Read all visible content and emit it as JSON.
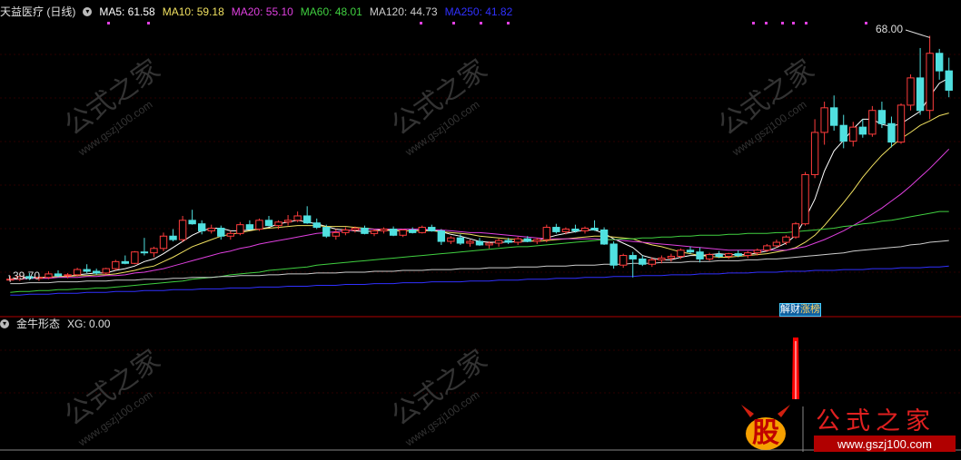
{
  "main_legend": {
    "title": "天益医疗 (日线)",
    "mas": [
      {
        "label": "MA5: 61.58",
        "color": "#ffffff"
      },
      {
        "label": "MA10: 59.18",
        "color": "#f0e060"
      },
      {
        "label": "MA20: 55.10",
        "color": "#e040e0"
      },
      {
        "label": "MA60: 48.01",
        "color": "#40d040"
      },
      {
        "label": "MA120: 44.73",
        "color": "#cccccc"
      },
      {
        "label": "MA250: 41.82",
        "color": "#3030ff"
      }
    ]
  },
  "sub_legend": {
    "title": "金牛形态",
    "value": "XG: 0.00"
  },
  "annotations": {
    "high": "68.00",
    "low": "39.70",
    "tag1": "解",
    "tag2": "财",
    "tag3": "涨",
    "tag4": "榜"
  },
  "watermark": {
    "text": "公式之家",
    "url": "www.gszj100.com"
  },
  "logo": {
    "glyph": "股",
    "text": "公式之家",
    "url": "www.gszj100.com"
  },
  "colors": {
    "up": "#ff3c3c",
    "down": "#50e0e0",
    "signal": "#ff0000",
    "grid": "#b00000"
  },
  "chart_data": {
    "type": "candlestick",
    "title": "天益医疗 (日线)",
    "y_range": [
      38,
      70
    ],
    "candles": [
      [
        40.2,
        40.7,
        40.0,
        40.3
      ],
      [
        40.3,
        40.9,
        40.1,
        40.6
      ],
      [
        40.6,
        41.0,
        40.2,
        40.4
      ],
      [
        40.4,
        40.8,
        40.1,
        40.5
      ],
      [
        40.5,
        41.2,
        40.3,
        40.9
      ],
      [
        40.9,
        41.3,
        40.5,
        40.7
      ],
      [
        40.7,
        41.0,
        40.4,
        40.8
      ],
      [
        40.8,
        41.6,
        40.6,
        41.4
      ],
      [
        41.4,
        42.0,
        41.0,
        41.2
      ],
      [
        41.2,
        41.5,
        40.8,
        41.0
      ],
      [
        41.0,
        41.6,
        40.8,
        41.5
      ],
      [
        41.5,
        42.5,
        41.3,
        42.3
      ],
      [
        42.3,
        43.0,
        42.0,
        42.1
      ],
      [
        42.1,
        43.5,
        42.0,
        43.4
      ],
      [
        43.4,
        45.0,
        43.0,
        43.3
      ],
      [
        43.3,
        44.0,
        42.8,
        43.8
      ],
      [
        43.8,
        45.6,
        43.5,
        45.2
      ],
      [
        45.2,
        46.0,
        44.6,
        44.8
      ],
      [
        44.8,
        47.5,
        44.5,
        47.0
      ],
      [
        47.0,
        48.2,
        46.5,
        46.6
      ],
      [
        46.6,
        47.0,
        45.4,
        45.8
      ],
      [
        45.8,
        46.5,
        45.5,
        46.1
      ],
      [
        46.1,
        46.4,
        44.8,
        45.2
      ],
      [
        45.2,
        45.8,
        44.8,
        45.5
      ],
      [
        45.5,
        46.8,
        45.3,
        46.5
      ],
      [
        46.5,
        47.0,
        45.9,
        46.0
      ],
      [
        46.0,
        47.2,
        45.8,
        47.0
      ],
      [
        47.0,
        47.5,
        46.3,
        46.4
      ],
      [
        46.4,
        47.0,
        46.0,
        46.8
      ],
      [
        46.8,
        47.6,
        46.4,
        47.0
      ],
      [
        47.0,
        48.0,
        46.8,
        47.5
      ],
      [
        47.5,
        48.6,
        46.6,
        46.7
      ],
      [
        46.7,
        47.2,
        46.0,
        46.2
      ],
      [
        46.2,
        46.5,
        45.0,
        45.2
      ],
      [
        45.2,
        46.0,
        44.8,
        45.6
      ],
      [
        45.6,
        46.2,
        45.3,
        45.9
      ],
      [
        45.9,
        46.3,
        45.6,
        46.1
      ],
      [
        46.1,
        46.4,
        45.4,
        45.5
      ],
      [
        45.5,
        46.0,
        45.2,
        45.8
      ],
      [
        45.8,
        46.2,
        45.5,
        46.0
      ],
      [
        46.0,
        46.3,
        45.2,
        45.3
      ],
      [
        45.3,
        46.0,
        45.1,
        45.9
      ],
      [
        45.9,
        46.2,
        45.5,
        45.6
      ],
      [
        45.6,
        46.4,
        45.5,
        46.2
      ],
      [
        46.2,
        46.5,
        45.7,
        45.8
      ],
      [
        45.8,
        46.0,
        44.2,
        44.6
      ],
      [
        44.6,
        45.2,
        44.3,
        45.0
      ],
      [
        45.0,
        45.4,
        44.2,
        44.4
      ],
      [
        44.4,
        44.8,
        44.0,
        44.6
      ],
      [
        44.6,
        45.0,
        44.1,
        44.2
      ],
      [
        44.2,
        44.6,
        43.8,
        44.4
      ],
      [
        44.4,
        44.9,
        44.0,
        44.7
      ],
      [
        44.7,
        45.0,
        44.3,
        44.5
      ],
      [
        44.5,
        45.1,
        44.2,
        44.9
      ],
      [
        44.9,
        45.2,
        44.5,
        44.6
      ],
      [
        44.6,
        45.0,
        44.3,
        44.8
      ],
      [
        44.8,
        46.5,
        44.5,
        46.2
      ],
      [
        46.2,
        46.6,
        45.5,
        45.7
      ],
      [
        45.7,
        46.2,
        45.4,
        46.0
      ],
      [
        46.0,
        46.5,
        45.6,
        45.8
      ],
      [
        45.8,
        46.3,
        45.5,
        46.1
      ],
      [
        46.1,
        47.0,
        45.8,
        45.9
      ],
      [
        45.9,
        46.2,
        44.2,
        44.3
      ],
      [
        44.3,
        44.6,
        41.5,
        41.9
      ],
      [
        41.9,
        43.2,
        41.6,
        43.0
      ],
      [
        43.0,
        43.4,
        40.5,
        42.6
      ],
      [
        42.6,
        43.0,
        41.8,
        42.0
      ],
      [
        42.0,
        42.8,
        41.7,
        42.5
      ],
      [
        42.5,
        43.0,
        42.1,
        42.7
      ],
      [
        42.7,
        43.2,
        42.3,
        42.9
      ],
      [
        42.9,
        43.8,
        42.6,
        43.6
      ],
      [
        43.6,
        44.0,
        43.2,
        43.4
      ],
      [
        43.4,
        43.9,
        42.2,
        42.6
      ],
      [
        42.6,
        43.3,
        42.4,
        43.1
      ],
      [
        43.1,
        43.5,
        42.7,
        42.9
      ],
      [
        42.9,
        43.3,
        42.6,
        43.2
      ],
      [
        43.2,
        43.6,
        42.8,
        43.0
      ],
      [
        43.0,
        43.5,
        42.7,
        43.3
      ],
      [
        43.3,
        43.8,
        43.0,
        43.6
      ],
      [
        43.6,
        44.3,
        43.4,
        44.1
      ],
      [
        44.1,
        44.8,
        43.9,
        44.5
      ],
      [
        44.5,
        45.3,
        44.2,
        45.1
      ],
      [
        45.1,
        46.8,
        44.9,
        46.6
      ],
      [
        46.6,
        52.5,
        46.4,
        52.2
      ],
      [
        52.2,
        58.5,
        51.8,
        57.0
      ],
      [
        57.0,
        60.5,
        55.6,
        59.8
      ],
      [
        59.8,
        61.2,
        57.2,
        57.8
      ],
      [
        57.8,
        59.0,
        55.2,
        56.0
      ],
      [
        56.0,
        58.2,
        55.4,
        57.6
      ],
      [
        57.6,
        58.5,
        56.4,
        56.8
      ],
      [
        56.8,
        60.0,
        56.5,
        59.5
      ],
      [
        59.5,
        60.5,
        57.5,
        58.0
      ],
      [
        58.0,
        58.8,
        55.3,
        55.9
      ],
      [
        55.9,
        60.3,
        55.7,
        60.1
      ],
      [
        60.1,
        63.6,
        59.5,
        63.2
      ],
      [
        63.2,
        66.6,
        59.0,
        59.5
      ],
      [
        59.5,
        68.0,
        58.5,
        66.0
      ],
      [
        66.0,
        66.5,
        63.0,
        64.0
      ],
      [
        64.0,
        65.5,
        61.0,
        61.8
      ]
    ],
    "ma5": [
      40.3,
      40.5,
      40.5,
      40.5,
      40.5,
      40.6,
      40.6,
      40.8,
      40.9,
      41.0,
      41.0,
      41.3,
      41.5,
      41.8,
      42.3,
      42.6,
      43.2,
      43.9,
      44.6,
      45.3,
      45.8,
      46.1,
      46.1,
      45.8,
      45.8,
      45.9,
      46.0,
      46.2,
      46.6,
      46.8,
      47.0,
      46.8,
      46.6,
      46.3,
      46.0,
      45.9,
      45.8,
      45.7,
      45.8,
      45.9,
      45.8,
      45.8,
      45.8,
      45.9,
      45.9,
      45.7,
      45.4,
      45.2,
      44.9,
      44.6,
      44.5,
      44.5,
      44.5,
      44.6,
      44.6,
      44.7,
      45.0,
      45.3,
      45.5,
      45.7,
      45.9,
      45.9,
      45.5,
      44.9,
      44.4,
      43.9,
      43.0,
      42.7,
      42.5,
      42.5,
      42.8,
      43.0,
      43.0,
      43.1,
      43.2,
      43.1,
      43.1,
      43.1,
      43.3,
      43.5,
      43.9,
      44.4,
      45.3,
      47.2,
      49.4,
      52.6,
      54.9,
      56.1,
      57.4,
      58.5,
      58.5,
      57.9,
      57.7,
      58.0,
      58.7,
      59.4,
      61.1,
      62.6,
      63.2
    ],
    "ma10": [
      40.3,
      40.4,
      40.4,
      40.5,
      40.5,
      40.6,
      40.6,
      40.7,
      40.7,
      40.8,
      40.8,
      40.9,
      41.1,
      41.3,
      41.6,
      41.8,
      42.3,
      42.8,
      43.4,
      44.0,
      44.4,
      44.8,
      45.2,
      45.4,
      45.6,
      45.8,
      46.0,
      46.1,
      46.2,
      46.3,
      46.4,
      46.4,
      46.4,
      46.3,
      46.3,
      46.3,
      46.2,
      46.1,
      46.0,
      45.9,
      45.9,
      45.8,
      45.8,
      45.8,
      45.8,
      45.7,
      45.6,
      45.5,
      45.4,
      45.2,
      45.1,
      45.0,
      44.9,
      44.8,
      44.7,
      44.6,
      44.7,
      44.8,
      44.9,
      45.0,
      45.1,
      45.2,
      45.2,
      45.1,
      45.0,
      44.9,
      44.5,
      44.2,
      44.0,
      43.7,
      43.4,
      43.2,
      43.0,
      42.9,
      42.8,
      42.8,
      42.9,
      43.0,
      43.1,
      43.2,
      43.4,
      43.6,
      43.9,
      44.5,
      45.3,
      46.4,
      47.7,
      49.0,
      50.4,
      51.9,
      53.2,
      54.4,
      55.4,
      56.3,
      57.0,
      57.8,
      58.3,
      58.9,
      59.2
    ],
    "ma20": [
      40.3,
      40.3,
      40.4,
      40.4,
      40.4,
      40.5,
      40.5,
      40.5,
      40.6,
      40.6,
      40.7,
      40.7,
      40.8,
      41.0,
      41.1,
      41.3,
      41.5,
      41.8,
      42.1,
      42.4,
      42.7,
      43.0,
      43.3,
      43.5,
      43.8,
      44.0,
      44.3,
      44.5,
      44.7,
      44.9,
      45.1,
      45.3,
      45.5,
      45.6,
      45.7,
      45.8,
      45.9,
      46.0,
      46.0,
      46.0,
      46.0,
      46.0,
      46.0,
      46.0,
      45.9,
      45.9,
      45.8,
      45.7,
      45.6,
      45.6,
      45.5,
      45.4,
      45.3,
      45.2,
      45.1,
      45.0,
      44.9,
      44.9,
      44.9,
      44.9,
      44.9,
      44.9,
      44.8,
      44.8,
      44.7,
      44.6,
      44.5,
      44.4,
      44.3,
      44.2,
      44.1,
      44.0,
      43.9,
      43.8,
      43.7,
      43.6,
      43.6,
      43.6,
      43.6,
      43.6,
      43.6,
      43.6,
      43.8,
      44.0,
      44.4,
      44.8,
      45.3,
      45.8,
      46.4,
      47.0,
      47.7,
      48.4,
      49.2,
      50.0,
      50.9,
      51.9,
      52.9,
      54.0,
      55.1
    ],
    "ma60": [
      38.8,
      38.9,
      38.9,
      39.0,
      39.0,
      39.1,
      39.1,
      39.2,
      39.2,
      39.3,
      39.3,
      39.4,
      39.5,
      39.6,
      39.7,
      39.8,
      39.9,
      40.0,
      40.1,
      40.3,
      40.4,
      40.5,
      40.6,
      40.8,
      40.9,
      41.0,
      41.1,
      41.3,
      41.4,
      41.5,
      41.6,
      41.7,
      41.9,
      42.0,
      42.1,
      42.2,
      42.3,
      42.4,
      42.5,
      42.6,
      42.7,
      42.8,
      42.9,
      43.0,
      43.1,
      43.2,
      43.3,
      43.4,
      43.5,
      43.6,
      43.7,
      43.8,
      43.9,
      44.0,
      44.0,
      44.1,
      44.2,
      44.3,
      44.4,
      44.5,
      44.6,
      44.7,
      44.8,
      44.8,
      44.9,
      44.9,
      45.0,
      45.0,
      45.1,
      45.1,
      45.2,
      45.2,
      45.3,
      45.3,
      45.3,
      45.4,
      45.4,
      45.5,
      45.5,
      45.5,
      45.6,
      45.6,
      45.7,
      45.8,
      45.9,
      46.0,
      46.1,
      46.3,
      46.4,
      46.6,
      46.7,
      46.9,
      47.0,
      47.2,
      47.4,
      47.6,
      47.8,
      48.0,
      48.0
    ],
    "ma120": [
      39.8,
      39.8,
      39.9,
      39.9,
      39.9,
      40.0,
      40.0,
      40.0,
      40.1,
      40.1,
      40.1,
      40.2,
      40.2,
      40.2,
      40.3,
      40.3,
      40.3,
      40.4,
      40.4,
      40.5,
      40.5,
      40.5,
      40.6,
      40.6,
      40.7,
      40.7,
      40.7,
      40.8,
      40.8,
      40.9,
      40.9,
      40.9,
      41.0,
      41.0,
      41.0,
      41.1,
      41.1,
      41.1,
      41.2,
      41.2,
      41.2,
      41.3,
      41.3,
      41.3,
      41.4,
      41.4,
      41.4,
      41.5,
      41.5,
      41.5,
      41.6,
      41.6,
      41.6,
      41.7,
      41.7,
      41.7,
      41.8,
      41.8,
      41.8,
      41.9,
      41.9,
      41.9,
      42.0,
      42.0,
      42.0,
      42.1,
      42.1,
      42.1,
      42.2,
      42.2,
      42.2,
      42.3,
      42.3,
      42.3,
      42.4,
      42.4,
      42.4,
      42.5,
      42.5,
      42.6,
      42.6,
      42.7,
      42.8,
      42.9,
      43.0,
      43.1,
      43.2,
      43.3,
      43.5,
      43.6,
      43.7,
      43.8,
      43.9,
      44.0,
      44.2,
      44.3,
      44.5,
      44.6,
      44.7
    ],
    "ma250": [
      38.5,
      38.5,
      38.6,
      38.6,
      38.6,
      38.7,
      38.7,
      38.7,
      38.8,
      38.8,
      38.8,
      38.9,
      38.9,
      38.9,
      39.0,
      39.0,
      39.0,
      39.1,
      39.1,
      39.1,
      39.2,
      39.2,
      39.2,
      39.3,
      39.3,
      39.3,
      39.4,
      39.4,
      39.4,
      39.5,
      39.5,
      39.5,
      39.6,
      39.6,
      39.6,
      39.7,
      39.7,
      39.7,
      39.8,
      39.8,
      39.8,
      39.9,
      39.9,
      39.9,
      40.0,
      40.0,
      40.0,
      40.0,
      40.1,
      40.1,
      40.1,
      40.2,
      40.2,
      40.2,
      40.3,
      40.3,
      40.3,
      40.4,
      40.4,
      40.4,
      40.5,
      40.5,
      40.5,
      40.6,
      40.6,
      40.6,
      40.7,
      40.7,
      40.7,
      40.8,
      40.8,
      40.8,
      40.9,
      40.9,
      40.9,
      41.0,
      41.0,
      41.0,
      41.1,
      41.1,
      41.1,
      41.2,
      41.2,
      41.2,
      41.3,
      41.3,
      41.3,
      41.4,
      41.4,
      41.4,
      41.5,
      41.5,
      41.5,
      41.6,
      41.6,
      41.6,
      41.7,
      41.7,
      41.8
    ],
    "signal_index": 82,
    "subchart_title": "金牛形态",
    "subchart_value": "XG: 0.00"
  }
}
